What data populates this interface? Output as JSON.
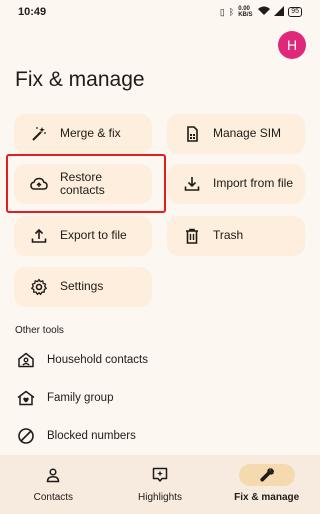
{
  "status_bar": {
    "time": "10:49",
    "network_speed": "0.00 KB/S",
    "battery": "95"
  },
  "avatar": {
    "initial": "H",
    "color": "#e0287a"
  },
  "page_title": "Fix & manage",
  "tiles": {
    "merge_fix": "Merge & fix",
    "manage_sim": "Manage SIM",
    "restore_contacts": "Restore contacts",
    "import_from_file": "Import from file",
    "export_to_file": "Export to file",
    "trash": "Trash",
    "settings": "Settings"
  },
  "other_tools": {
    "label": "Other tools",
    "items": [
      {
        "label": "Household contacts",
        "icon": "home-person-icon"
      },
      {
        "label": "Family group",
        "icon": "family-home-icon"
      },
      {
        "label": "Blocked numbers",
        "icon": "block-icon"
      }
    ]
  },
  "bottom_nav": {
    "items": [
      {
        "label": "Contacts",
        "icon": "person-icon",
        "active": false
      },
      {
        "label": "Highlights",
        "icon": "highlights-icon",
        "active": false
      },
      {
        "label": "Fix & manage",
        "icon": "wrench-icon",
        "active": true
      }
    ]
  },
  "colors": {
    "background": "#fdf7f2",
    "tile": "#fdeedd",
    "accent": "#f5dab0",
    "highlight_border": "#e02020"
  }
}
